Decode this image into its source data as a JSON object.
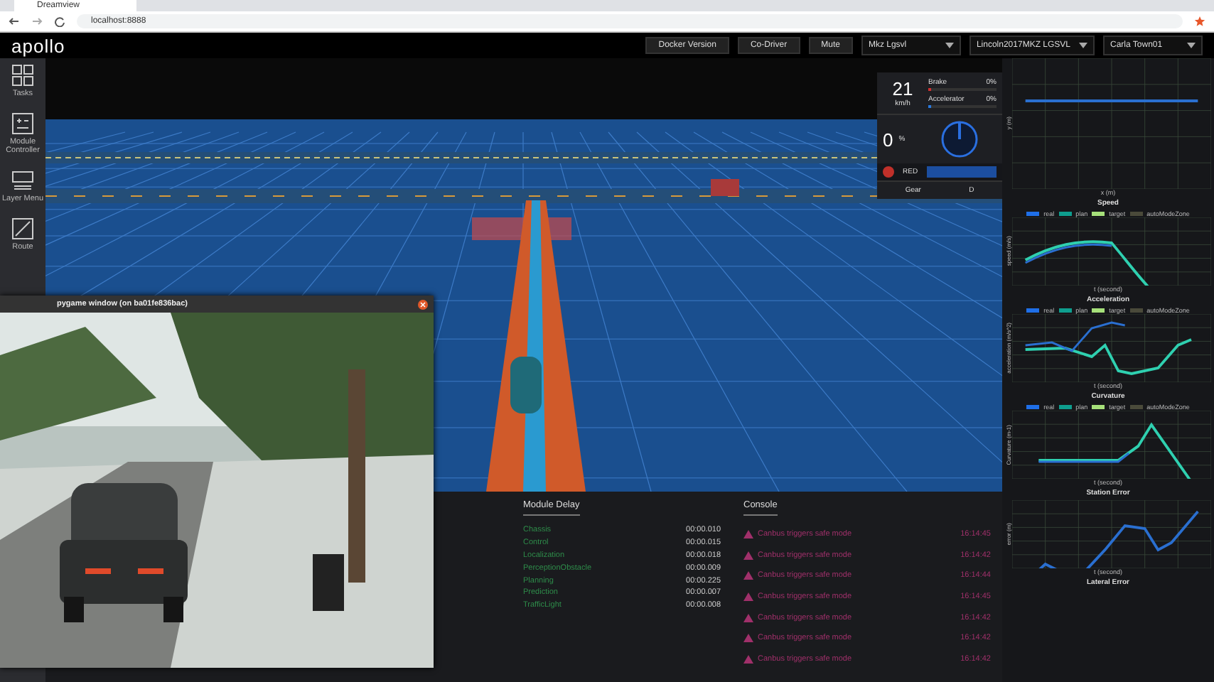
{
  "browser": {
    "tab_title": "Dreamview",
    "url": "localhost:8888"
  },
  "header": {
    "logo": "apollo",
    "buttons": [
      "Docker Version",
      "Co-Driver",
      "Mute"
    ],
    "selects": [
      "Mkz Lgsvl",
      "Lincoln2017MKZ LGSVL",
      "Carla Town01"
    ]
  },
  "sidebar": {
    "items": [
      {
        "label": "Tasks",
        "kind": "grid"
      },
      {
        "label": "Module Controller",
        "kind": "controller"
      },
      {
        "label": "Layer Menu",
        "kind": "layers"
      },
      {
        "label": "Route",
        "kind": "route"
      }
    ]
  },
  "dashboard": {
    "speed": "21",
    "speed_unit": "km/h",
    "brake": {
      "label": "Brake",
      "reading": "0%",
      "level": 0
    },
    "accelerator": {
      "label": "Accelerator",
      "reading": "0%",
      "level": 0
    },
    "steering": "0",
    "steering_unit": "%",
    "signal": "RED",
    "gear_label": "Gear",
    "gear": "D"
  },
  "module_delay": {
    "title": "Module Delay",
    "items": [
      {
        "name": "Chassis",
        "delay": "00:00.010"
      },
      {
        "name": "Control",
        "delay": "00:00.015"
      },
      {
        "name": "Localization",
        "delay": "00:00.018"
      },
      {
        "name": "PerceptionObstacle",
        "delay": "00:00.009"
      },
      {
        "name": "Planning",
        "delay": "00:00.225"
      },
      {
        "name": "Prediction",
        "delay": "00:00.007"
      },
      {
        "name": "TrafficLight",
        "delay": "00:00.008"
      }
    ]
  },
  "console": {
    "title": "Console",
    "messages": [
      {
        "text": "Canbus triggers safe mode",
        "time": "16:14:45"
      },
      {
        "text": "Canbus triggers safe mode",
        "time": "16:14:42"
      },
      {
        "text": "Canbus triggers safe mode",
        "time": "16:14:44"
      },
      {
        "text": "Canbus triggers safe mode",
        "time": "16:14:45"
      },
      {
        "text": "Canbus triggers safe mode",
        "time": "16:14:42"
      },
      {
        "text": "Canbus triggers safe mode",
        "time": "16:14:42"
      },
      {
        "text": "Canbus triggers safe mode",
        "time": "16:14:42"
      }
    ]
  },
  "pygame": {
    "title": "pygame window (on ba01fe836bac)"
  },
  "charts": [
    {
      "kind": "trajectory",
      "ylabel": "y (m)",
      "xlabel": "x (m)"
    },
    {
      "kind": "speed",
      "title": "Speed",
      "ylabel": "speed (m/s)",
      "xlabel": "t (second)",
      "legend": [
        {
          "label": "real",
          "color": "#1f6fe8"
        },
        {
          "label": "plan",
          "color": "#0e9e8e"
        },
        {
          "label": "target",
          "color": "#a6e07a"
        },
        {
          "label": "autoModeZone",
          "color": "#4a4a3a"
        }
      ]
    },
    {
      "kind": "acceleration",
      "title": "Acceleration",
      "ylabel": "acceleration (m/s^2)",
      "xlabel": "t (second)",
      "legend": [
        {
          "label": "real",
          "color": "#1f6fe8"
        },
        {
          "label": "plan",
          "color": "#0e9e8e"
        },
        {
          "label": "target",
          "color": "#a6e07a"
        },
        {
          "label": "autoModeZone",
          "color": "#4a4a3a"
        }
      ]
    },
    {
      "kind": "curvature",
      "title": "Curvature",
      "ylabel": "Curvature (m-1)",
      "xlabel": "t (second)",
      "legend": [
        {
          "label": "real",
          "color": "#1f6fe8"
        },
        {
          "label": "plan",
          "color": "#0e9e8e"
        },
        {
          "label": "target",
          "color": "#a6e07a"
        },
        {
          "label": "autoModeZone",
          "color": "#4a4a3a"
        }
      ]
    },
    {
      "kind": "station",
      "title": "Station Error",
      "ylabel": "error (m)",
      "xlabel": "t (second)"
    },
    {
      "kind": "lateral",
      "title": "Lateral Error"
    }
  ]
}
